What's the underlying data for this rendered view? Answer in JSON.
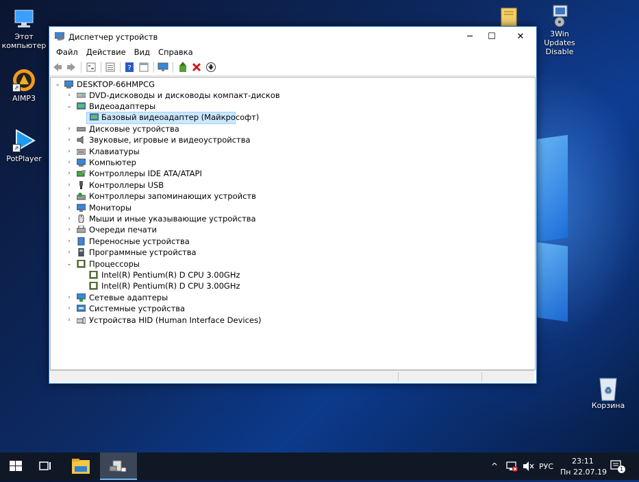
{
  "desktop": {
    "icons": [
      {
        "name": "this-pc",
        "label": "Этот компьютер"
      },
      {
        "name": "aimp3",
        "label": "AIMP3"
      },
      {
        "name": "potplayer",
        "label": "PotPlayer"
      },
      {
        "name": "folder",
        "label": ""
      },
      {
        "name": "win-updates",
        "label": "3Win Updates Disable"
      },
      {
        "name": "recycle-bin",
        "label": "Корзина"
      }
    ]
  },
  "window": {
    "title": "Диспетчер устройств",
    "menu": [
      "Файл",
      "Действие",
      "Вид",
      "Справка"
    ],
    "tree": {
      "root": "DESKTOP-66HMPCG",
      "items": [
        {
          "label": "DVD-дисководы и дисководы компакт-дисков",
          "expanded": false
        },
        {
          "label": "Видеоадаптеры",
          "expanded": true,
          "children": [
            "Базовый видеоадаптер (Майкрософт)"
          ]
        },
        {
          "label": "Дисковые устройства",
          "expanded": false
        },
        {
          "label": "Звуковые, игровые и видеоустройства",
          "expanded": false
        },
        {
          "label": "Клавиатуры",
          "expanded": false
        },
        {
          "label": "Компьютер",
          "expanded": false
        },
        {
          "label": "Контроллеры IDE ATA/ATAPI",
          "expanded": false
        },
        {
          "label": "Контроллеры USB",
          "expanded": false
        },
        {
          "label": "Контроллеры запоминающих устройств",
          "expanded": false
        },
        {
          "label": "Мониторы",
          "expanded": false
        },
        {
          "label": "Мыши и иные указывающие устройства",
          "expanded": false
        },
        {
          "label": "Очереди печати",
          "expanded": false
        },
        {
          "label": "Переносные устройства",
          "expanded": false
        },
        {
          "label": "Программные устройства",
          "expanded": false
        },
        {
          "label": "Процессоры",
          "expanded": true,
          "children": [
            "Intel(R) Pentium(R) D CPU 3.00GHz",
            "Intel(R) Pentium(R) D CPU 3.00GHz"
          ]
        },
        {
          "label": "Сетевые адаптеры",
          "expanded": false
        },
        {
          "label": "Системные устройства",
          "expanded": false
        },
        {
          "label": "Устройства HID (Human Interface Devices)",
          "expanded": false
        }
      ]
    }
  },
  "taskbar": {
    "language": "РУС",
    "time": "23:11",
    "date": "Пн 22.07.19",
    "notification_count": "1"
  }
}
